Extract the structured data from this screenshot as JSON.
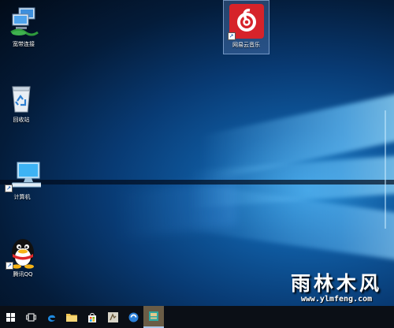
{
  "desktop": {
    "icons": [
      {
        "label": "宽带连接",
        "icon": "network-icon"
      },
      {
        "label": "回收站",
        "icon": "recycle-bin-icon"
      },
      {
        "label": "计算机",
        "icon": "computer-icon"
      },
      {
        "label": "腾讯QQ",
        "icon": "qq-penguin-icon"
      },
      {
        "label": "网易云音乐",
        "icon": "netease-music-icon"
      }
    ]
  },
  "watermark": {
    "title": "雨林木风",
    "url": "www.ylmfeng.com"
  },
  "taskbar": {
    "buttons": [
      "start-icon",
      "task-view-icon",
      "edge-icon",
      "file-explorer-icon",
      "store-icon",
      "app-icon",
      "browser-icon",
      "media-player-icon"
    ]
  },
  "colors": {
    "netease_red": "#d6232a",
    "qq_yellow": "#f5b316",
    "taskbar": "#0b0f16"
  }
}
